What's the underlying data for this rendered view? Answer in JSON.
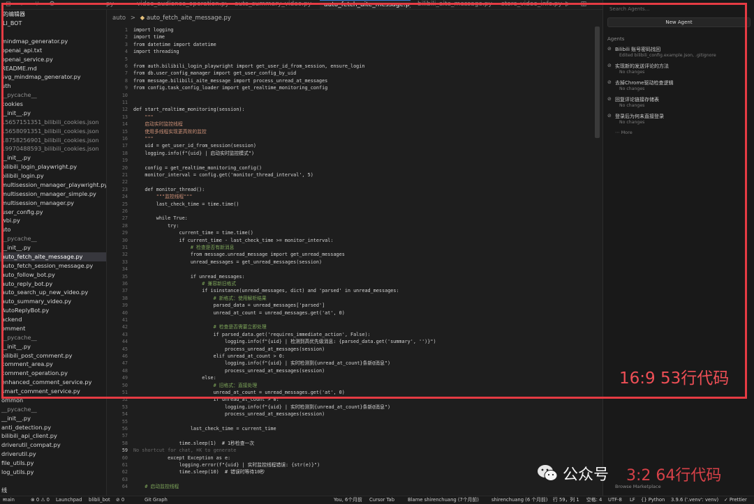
{
  "tabs": [
    {
      "label": "py"
    },
    {
      "label": "video_audience_operation.py"
    },
    {
      "label": "auto_summary_video.py"
    },
    {
      "label": "auto_fetch_aite_message.py",
      "active": true
    },
    {
      "label": "bilibili_aite_message.py"
    },
    {
      "label": "store_video_info.py"
    }
  ],
  "sidebar": {
    "header": "的编辑器",
    "root": "LI_BOT",
    "items": [
      {
        "label": "",
        "dim": false
      },
      {
        "label": "mindmap_generator.py"
      },
      {
        "label": "openai_api.txt"
      },
      {
        "label": "openai_service.py"
      },
      {
        "label": "README.md"
      },
      {
        "label": "svg_mindmap_generator.py"
      },
      {
        "label": "uth"
      },
      {
        "label": "__pycache__",
        "dim": true
      },
      {
        "label": "cookies"
      },
      {
        "label": "__init__.py"
      },
      {
        "label": "15657151351_bilibili_cookies.json",
        "dim": true
      },
      {
        "label": "15658091351_bilibili_cookies.json",
        "dim": true
      },
      {
        "label": "18758256901_bilibili_cookies.json",
        "dim": true
      },
      {
        "label": "19970488593_bilibili_cookies.json",
        "dim": true
      },
      {
        "label": "__init__.py"
      },
      {
        "label": "bilibili_login_playwright.py"
      },
      {
        "label": "bilibili_login.py"
      },
      {
        "label": "multisession_manager_playwright.py"
      },
      {
        "label": "multisession_manager_simple.py"
      },
      {
        "label": "multisession_manager.py"
      },
      {
        "label": "user_config.py"
      },
      {
        "label": "wbi.py"
      },
      {
        "label": "uto"
      },
      {
        "label": "__pycache__",
        "dim": true
      },
      {
        "label": "__init__.py"
      },
      {
        "label": "auto_fetch_aite_message.py",
        "selected": true
      },
      {
        "label": "auto_fetch_session_message.py"
      },
      {
        "label": "auto_follow_bot.py"
      },
      {
        "label": "auto_reply_bot.py"
      },
      {
        "label": "auto_search_up_new_video.py"
      },
      {
        "label": "auto_summary_video.py"
      },
      {
        "label": "AutoReplyBot.py"
      },
      {
        "label": "ackend"
      },
      {
        "label": "omment"
      },
      {
        "label": "__pycache__",
        "dim": true
      },
      {
        "label": "__init__.py"
      },
      {
        "label": "bilibili_post_comment.py"
      },
      {
        "label": "comment_area.py"
      },
      {
        "label": "comment_operation.py"
      },
      {
        "label": "enhanced_comment_service.py"
      },
      {
        "label": "smart_comment_service.py"
      },
      {
        "label": "ommon"
      },
      {
        "label": "__pycache__",
        "dim": true
      },
      {
        "label": "__init__.py"
      },
      {
        "label": "anti_detection.py"
      },
      {
        "label": "bilibili_api_client.py"
      },
      {
        "label": "driverutil_compat.py"
      },
      {
        "label": "driverutil.py"
      },
      {
        "label": "file_utils.py"
      },
      {
        "label": "log_utils.py"
      },
      {
        "label": ""
      },
      {
        "label": "线"
      }
    ]
  },
  "breadcrumb": {
    "folder": "auto",
    "sep": ">",
    "file": "auto_fetch_aite_message.py"
  },
  "editor": {
    "lines": [
      {
        "n": "1",
        "code": "import logging"
      },
      {
        "n": "2",
        "code": "import time"
      },
      {
        "n": "3",
        "code": "from datetime import datetime"
      },
      {
        "n": "4",
        "code": "import threading"
      },
      {
        "n": "5",
        "code": ""
      },
      {
        "n": "6",
        "code": "from auth.bilibili_login_playwright import get_user_id_from_session, ensure_login"
      },
      {
        "n": "7",
        "code": "from db.user_config_manager import get_user_config_by_uid"
      },
      {
        "n": "8",
        "code": "from message.bilibili_aite_message import process_unread_at_messages"
      },
      {
        "n": "9",
        "code": "from config.task_config_loader import get_realtime_monitoring_config"
      },
      {
        "n": "10",
        "code": ""
      },
      {
        "n": "11",
        "code": ""
      },
      {
        "n": "12",
        "code": "def start_realtime_monitoring(session):"
      },
      {
        "n": "13",
        "code": "    \"\"\"",
        "kind": "doc"
      },
      {
        "n": "14",
        "code": "    启动实时监控线程",
        "kind": "doc"
      },
      {
        "n": "15",
        "code": "    使用多线程实现更高效的监控",
        "kind": "doc"
      },
      {
        "n": "16",
        "code": "    \"\"\"",
        "kind": "doc"
      },
      {
        "n": "17",
        "code": "    uid = get_user_id_from_session(session)"
      },
      {
        "n": "18",
        "code": "    logging.info(f\"{uid} | 启动实时监控模式\")"
      },
      {
        "n": "19",
        "code": ""
      },
      {
        "n": "20",
        "code": "    config = get_realtime_monitoring_config()"
      },
      {
        "n": "21",
        "code": "    monitor_interval = config.get('monitor_thread_interval', 5)"
      },
      {
        "n": "22",
        "code": ""
      },
      {
        "n": "23",
        "code": "    def monitor_thread():"
      },
      {
        "n": "24",
        "code": "        \"\"\"监控线程\"\"\"",
        "kind": "doc"
      },
      {
        "n": "25",
        "code": "        last_check_time = time.time()"
      },
      {
        "n": "26",
        "code": ""
      },
      {
        "n": "27",
        "code": "        while True:"
      },
      {
        "n": "28",
        "code": "            try:"
      },
      {
        "n": "29",
        "code": "                current_time = time.time()"
      },
      {
        "n": "30",
        "code": "                if current_time - last_check_time >= monitor_interval:"
      },
      {
        "n": "31",
        "code": "                    # 检查是否有新消息",
        "kind": "comment"
      },
      {
        "n": "32",
        "code": "                    from message.unread_message import get_unread_messages"
      },
      {
        "n": "33",
        "code": "                    unread_messages = get_unread_messages(session)"
      },
      {
        "n": "34",
        "code": ""
      },
      {
        "n": "35",
        "code": "                    if unread_messages:"
      },
      {
        "n": "36",
        "code": "                        # 兼容新旧格式",
        "kind": "comment"
      },
      {
        "n": "37",
        "code": "                        if isinstance(unread_messages, dict) and 'parsed' in unread_messages:"
      },
      {
        "n": "38",
        "code": "                            # 新格式：使用解析结果",
        "kind": "comment"
      },
      {
        "n": "39",
        "code": "                            parsed_data = unread_messages['parsed']"
      },
      {
        "n": "40",
        "code": "                            unread_at_count = unread_messages.get('at', 0)"
      },
      {
        "n": "41",
        "code": ""
      },
      {
        "n": "42",
        "code": "                            # 检查是否需要立即处理",
        "kind": "comment"
      },
      {
        "n": "43",
        "code": "                            if parsed_data.get('requires_immediate_action', False):"
      },
      {
        "n": "44",
        "code": "                                logging.info(f\"{uid} | 检测到高优先级消息: {parsed_data.get('summary', '')}\")"
      },
      {
        "n": "45",
        "code": "                                process_unread_at_messages(session)"
      },
      {
        "n": "46",
        "code": "                            elif unread_at_count > 0:"
      },
      {
        "n": "47",
        "code": "                                logging.info(f\"{uid} | 实时检测到{unread_at_count}条新@消息\")"
      },
      {
        "n": "48",
        "code": "                                process_unread_at_messages(session)"
      },
      {
        "n": "49",
        "code": "                        else:"
      },
      {
        "n": "50",
        "code": "                            # 旧格式：直接处理",
        "kind": "comment"
      },
      {
        "n": "51",
        "code": "                            unread_at_count = unread_messages.get('at', 0)"
      },
      {
        "n": "52",
        "code": "                            if unread_at_count > 0:"
      },
      {
        "n": "53",
        "code": "                                logging.info(f\"{uid} | 实时检测到{unread_at_count}条新@消息\")"
      },
      {
        "n": "54",
        "code": "                                process_unread_at_messages(session)"
      },
      {
        "n": "55",
        "code": ""
      },
      {
        "n": "56",
        "code": "                    last_check_time = current_time"
      },
      {
        "n": "57",
        "code": ""
      },
      {
        "n": "58",
        "code": "                time.sleep(1)  # 1秒检查一次"
      },
      {
        "n": "59",
        "code": "No shortcut for chat, ⌘K to generate",
        "kind": "hint",
        "current": true
      },
      {
        "n": "60",
        "code": "            except Exception as e:"
      },
      {
        "n": "61",
        "code": "                logging.error(f\"{uid} | 实时监控线程错误: {str(e)}\")"
      },
      {
        "n": "62",
        "code": "                time.sleep(10)  # 错误时等待10秒"
      },
      {
        "n": "63",
        "code": ""
      },
      {
        "n": "64",
        "code": "    # 启动监控线程",
        "kind": "comment"
      }
    ]
  },
  "agents_panel": {
    "search_placeholder": "Search Agents...",
    "new_agent": "New Agent",
    "title": "Agents",
    "items": [
      {
        "title": "Bilibili 账号密码找回",
        "sub": "Edited bilibili_config.example.json, .gitignore"
      },
      {
        "title": "实现新的发送评论的方法",
        "sub": "No changes"
      },
      {
        "title": "去掉Chrome驱动检查逻辑",
        "sub": "No changes"
      },
      {
        "title": "回复评论链接存储表",
        "sub": "No changes"
      },
      {
        "title": "登录后为何未直接登录",
        "sub": "No changes"
      }
    ],
    "more": "More",
    "browse": "Browse Marketplace"
  },
  "statusbar": {
    "branch": "main",
    "problems": "⊗ 0 ⚠ 0",
    "launchpad": "Launchpad",
    "bot": "blibli_bot",
    "ports": "⊘ 0",
    "graph": "Git Graph",
    "blame1": "You, 6个月前",
    "tab": "Cursor Tab",
    "blame2": "Blame shirenchuang (7个月前)",
    "blame3": "shirenchuang (6 个月前)",
    "position": "行 59，列 1",
    "spaces": "空格: 4",
    "encoding": "UTF-8",
    "eol": "LF",
    "lang": "{} Python",
    "interpreter": "3.9.6 ('.venv': venv)",
    "prettier": "✓ Prettier"
  },
  "overlay": {
    "caption": "16:9 53行代码",
    "watermark": "公众号",
    "watermark_red": "3:2 64行代码",
    "colors": {
      "box": "#e53b43",
      "caption": "#ef4f56"
    }
  }
}
